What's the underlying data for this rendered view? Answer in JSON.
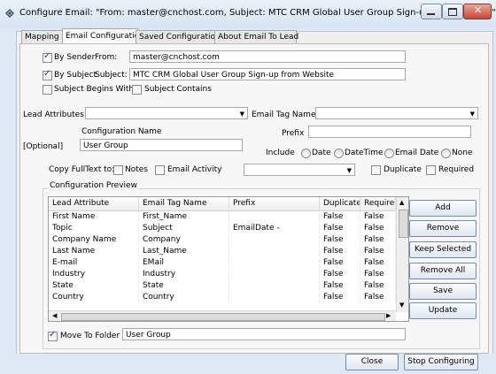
{
  "window": {
    "title": "Configure Email: \"From: master@cnchost.com, Subject: MTC CRM Global User Group Sign-up from Website\"",
    "controls": [
      "minimize",
      "maximize",
      "close"
    ]
  },
  "tabs": [
    {
      "label": "Mapping",
      "active": false
    },
    {
      "label": "Email Configuration",
      "active": true
    },
    {
      "label": "Saved Configurations",
      "active": false
    },
    {
      "label": "About Email To Lead",
      "active": false
    }
  ],
  "filters": {
    "by_sender": {
      "label": "By Sender",
      "checked": true,
      "field_label": "From:",
      "value": "master@cnchost.com"
    },
    "by_subject": {
      "label": "By Subject",
      "checked": true,
      "field_label": "Subject:",
      "value": "MTC CRM Global User Group Sign-up from Website"
    },
    "subject_begins_with": {
      "label": "Subject Begins With",
      "checked": false
    },
    "subject_contains": {
      "label": "Subject Contains",
      "checked": false
    }
  },
  "mapping": {
    "lead_attributes_label": "Lead Attributes",
    "lead_attributes_value": "",
    "email_tag_names_label": "Email Tag Names",
    "email_tag_names_value": "",
    "configuration_name_label": "Configuration Name",
    "optional_label": "[Optional]",
    "configuration_name_value": "User Group",
    "prefix_label": "Prefix",
    "prefix_value": "",
    "include_label": "Include",
    "include_options": [
      "Date",
      "DateTime",
      "Email Date",
      "None"
    ],
    "copy_fulltext_label": "Copy FullText to:",
    "notes_label": "Notes",
    "email_activity_label": "Email Activity",
    "copy_combo_value": "",
    "duplicate_label": "Duplicate",
    "required_label": "Required"
  },
  "preview": {
    "group_label": "Configuration Preview",
    "columns": [
      "Lead Attribute",
      "Email Tag Name",
      "Prefix",
      "Duplicate",
      "Required"
    ],
    "rows": [
      [
        "First Name",
        "First_Name",
        "",
        "False",
        "False"
      ],
      [
        "Topic",
        "Subject",
        "EmailDate  -",
        "False",
        "False"
      ],
      [
        "Company Name",
        "Company",
        "",
        "False",
        "False"
      ],
      [
        "Last Name",
        "Last_Name",
        "",
        "False",
        "False"
      ],
      [
        "E-mail",
        "EMail",
        "",
        "False",
        "False"
      ],
      [
        "Industry",
        "Industry",
        "",
        "False",
        "False"
      ],
      [
        "State",
        "State",
        "",
        "False",
        "False"
      ],
      [
        "Country",
        "Country",
        "",
        "False",
        "False"
      ]
    ],
    "header_cut_label": "Requirec"
  },
  "side_buttons": {
    "add": "Add",
    "remove": "Remove",
    "keep_selected": "Keep Selected",
    "remove_all": "Remove All",
    "save": "Save",
    "update": "Update"
  },
  "move_to_folder": {
    "label": "Move To Folder",
    "checked": true,
    "value": "User Group"
  },
  "footer": {
    "close": "Close",
    "stop": "Stop Configuring"
  },
  "colors": {
    "accent": "#6f8eb5",
    "titlebar": "#dfe9f5",
    "check": "#1d3f8a"
  }
}
